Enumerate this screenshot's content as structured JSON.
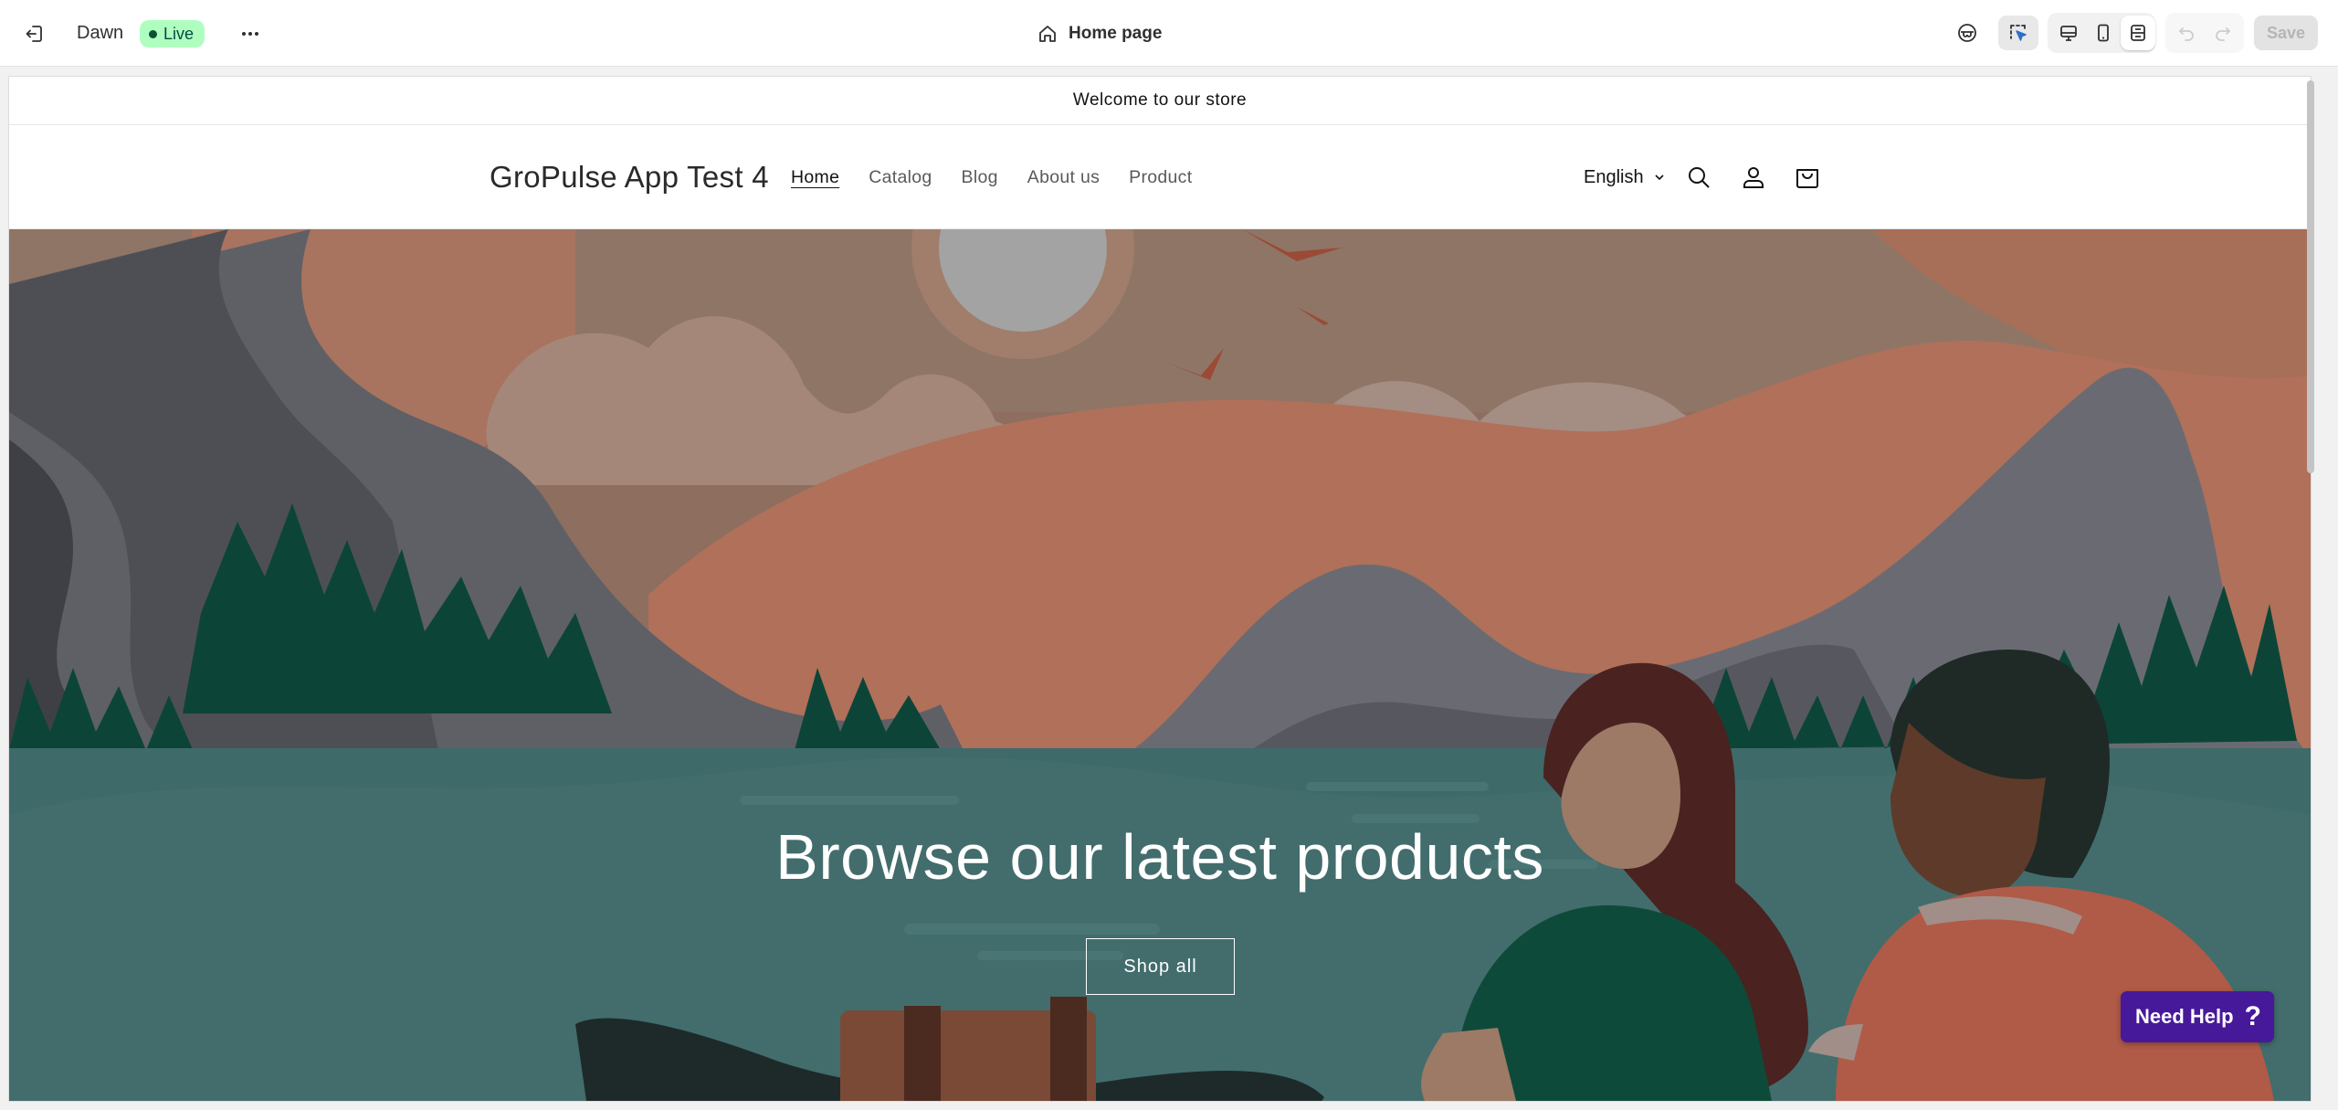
{
  "editor": {
    "theme_name": "Dawn",
    "live_badge": "Live",
    "page_selector": "Home page",
    "save_label": "Save",
    "icons": {
      "exit": "exit-icon",
      "more": "more-horizontal-icon",
      "home": "home-icon",
      "inspector": "inspector-icon",
      "select": "select-cursor-icon",
      "desktop": "desktop-icon",
      "mobile": "mobile-icon",
      "fullwidth": "fullscreen-icon",
      "undo": "undo-icon",
      "redo": "redo-icon"
    },
    "colors": {
      "live_badge_bg": "#affebf",
      "live_badge_text": "#014b40"
    }
  },
  "store": {
    "announcement": "Welcome to our store",
    "logo_text": "GroPulse App Test 4",
    "nav": [
      {
        "label": "Home",
        "active": true
      },
      {
        "label": "Catalog",
        "active": false
      },
      {
        "label": "Blog",
        "active": false
      },
      {
        "label": "About us",
        "active": false
      },
      {
        "label": "Product",
        "active": false
      }
    ],
    "language": "English",
    "hero": {
      "title": "Browse our latest products",
      "button_label": "Shop all"
    }
  },
  "help_widget": {
    "label": "Need Help",
    "icon": "?",
    "color": "#46199a"
  }
}
